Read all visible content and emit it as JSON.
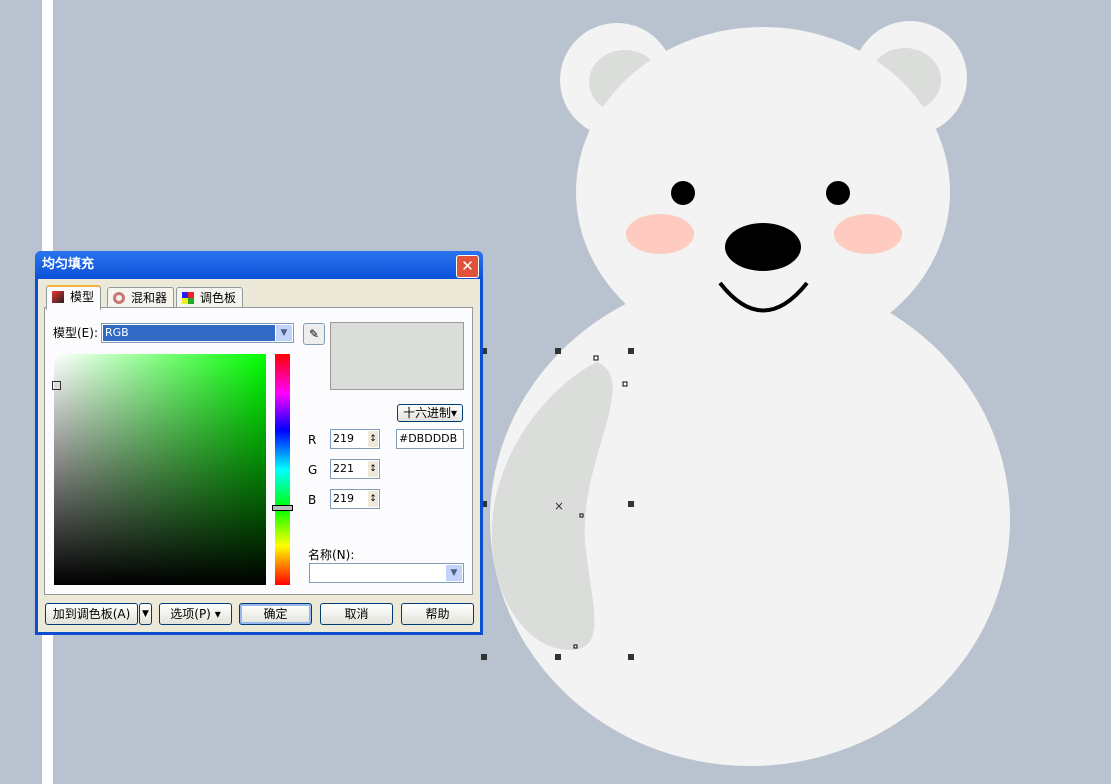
{
  "dialog": {
    "title": "均匀填充",
    "tabs": [
      {
        "label": "模型",
        "icon": "model-icon"
      },
      {
        "label": "混和器",
        "icon": "mixer-icon"
      },
      {
        "label": "调色板",
        "icon": "palette-icon"
      }
    ],
    "model_label": "模型(E):",
    "model_value": "RGB",
    "hex_mode": "十六进制",
    "hex_value": "#DBDDDB",
    "channels": [
      {
        "label": "R",
        "value": "219"
      },
      {
        "label": "G",
        "value": "221"
      },
      {
        "label": "B",
        "value": "219"
      }
    ],
    "name_label": "名称(N):",
    "name_value": "",
    "buttons": {
      "add_palette": "加到调色板(A)",
      "options": "选项(P)",
      "ok": "确定",
      "cancel": "取消",
      "help": "帮助"
    },
    "preview_color": "#DBDDDB"
  },
  "colors": {
    "canvas": "#b9c3cf",
    "bear": "#f3f3f3",
    "bear_shade": "#dbdddb",
    "cheek": "#ffcbc0",
    "accent": "#0b4fd0"
  }
}
